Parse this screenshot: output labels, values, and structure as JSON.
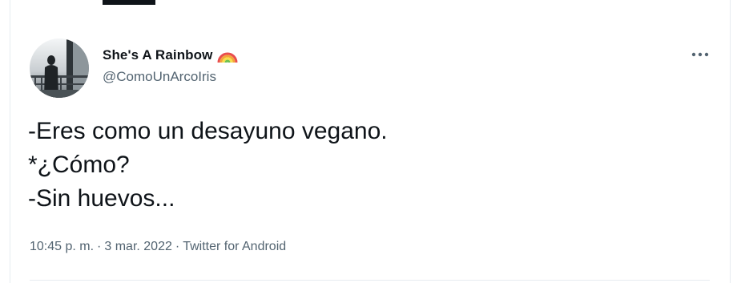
{
  "tweet": {
    "author": {
      "display_name": "She's A Rainbow",
      "display_name_emoji": "rainbow-icon",
      "handle": "@ComoUnArcoIris"
    },
    "text_lines": [
      "-Eres como un desayuno vegano.",
      "*¿Cómo?",
      "-Sin huevos..."
    ],
    "time": "10:45 p. m.",
    "separator": "·",
    "date": "3 mar. 2022",
    "source": "Twitter for Android"
  },
  "colors": {
    "text_primary": "#0f1419",
    "text_secondary": "#536471",
    "divider": "#e6ecf0"
  }
}
